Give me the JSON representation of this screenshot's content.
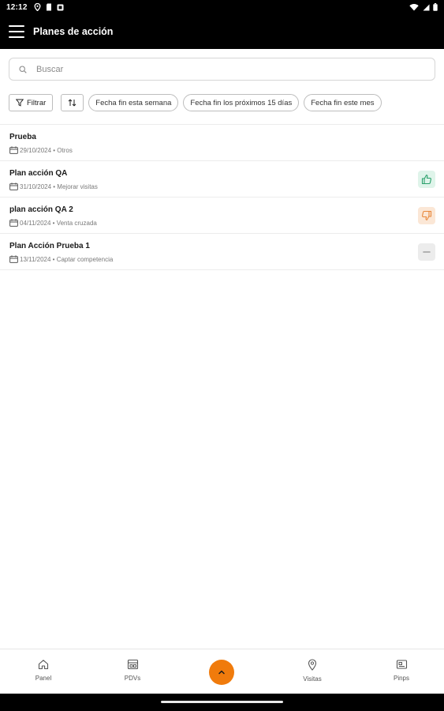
{
  "status_bar": {
    "time": "12:12"
  },
  "app_bar": {
    "title": "Planes de acción"
  },
  "search": {
    "placeholder": "Buscar"
  },
  "filters": {
    "filter_label": "Filtrar",
    "chips": [
      "Fecha fin esta semana",
      "Fecha fin los próximos 15 días",
      "Fecha fin este mes"
    ]
  },
  "plans": [
    {
      "name": "Prueba",
      "date": "29/10/2024",
      "category": "Otros",
      "status": "none"
    },
    {
      "name": "Plan acción QA",
      "date": "31/10/2024",
      "category": "Mejorar visitas",
      "status": "thumbs-up"
    },
    {
      "name": "plan acción QA 2",
      "date": "04/11/2024",
      "category": "Venta cruzada",
      "status": "thumbs-down"
    },
    {
      "name": "Plan Acción Prueba 1",
      "date": "13/11/2024",
      "category": "Captar competencia",
      "status": "neutral"
    }
  ],
  "bottom_nav": {
    "items": [
      {
        "label": "Panel",
        "icon": "home-icon"
      },
      {
        "label": "PDVs",
        "icon": "store-icon"
      },
      {
        "label": "Visitas",
        "icon": "location-pin-icon"
      },
      {
        "label": "Pinps",
        "icon": "image-card-icon"
      }
    ],
    "fab_icon": "chevron-up-icon"
  },
  "colors": {
    "accent": "#f07b0c",
    "thumbs_up": "#2aa06b",
    "thumbs_down": "#e8873a",
    "neutral": "#9e9e9e",
    "app_bar_bg": "#000000"
  }
}
